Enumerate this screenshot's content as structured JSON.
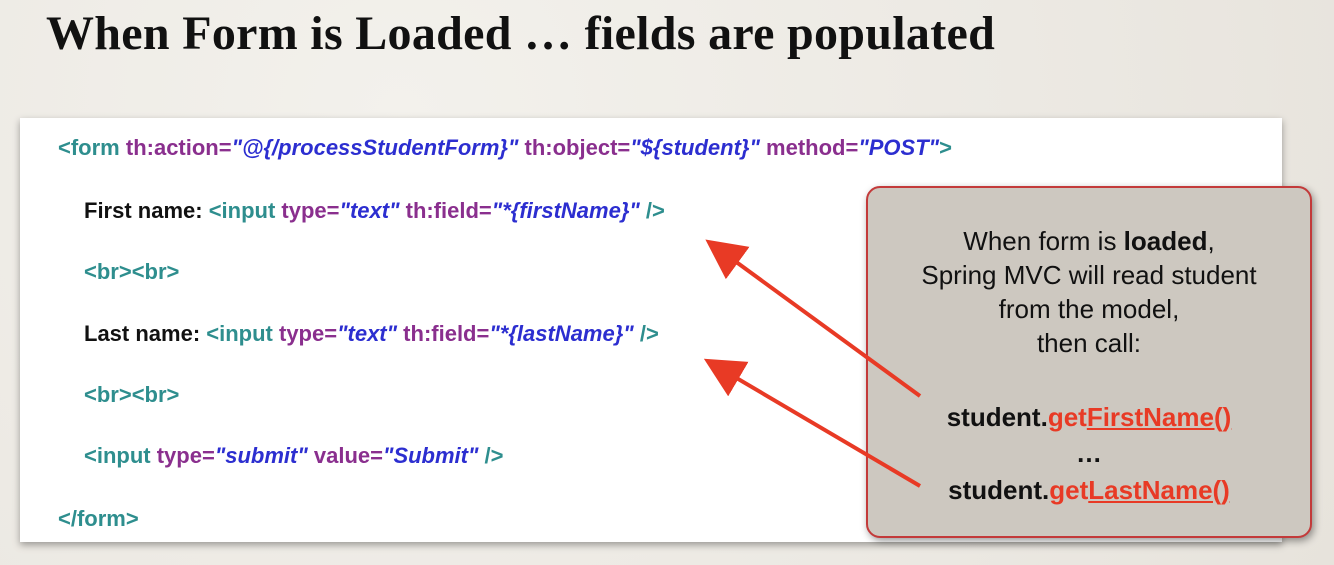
{
  "title": "When Form is Loaded … fields are populated",
  "code": {
    "line1": {
      "p1": "<form",
      "p2": " th:action=",
      "p3": "\"@{/processStudentForm}\"",
      "p4": " th:object=",
      "p5": "\"${student}\"",
      "p6": " method=",
      "p7": "\"POST\"",
      "p8": ">"
    },
    "line2": {
      "p0": "First name: ",
      "p1": "<input",
      "p2": " type=",
      "p3": "\"text\"",
      "p4": "  th:field=",
      "p5": "\"*{firstName}\"",
      "p6": " />"
    },
    "line3": "<br><br>",
    "line4": {
      "p0": "Last name: ",
      "p1": "<input",
      "p2": " type=",
      "p3": "\"text\"",
      "p4": "  th:field=",
      "p5": "\"*{lastName}\"",
      "p6": " />"
    },
    "line5": "<br><br>",
    "line6": {
      "p1": "<input",
      "p2": " type=",
      "p3": "\"submit\"",
      "p4": " value=",
      "p5": "\"Submit\"",
      "p6": " />"
    },
    "line7": "</form>"
  },
  "callout": {
    "l1_pre": "When form is ",
    "l1_bold": "loaded",
    "l1_post": ",",
    "l2": "Spring MVC will read student",
    "l3": "from the model,",
    "l4": "then call:",
    "c1_obj": "student.",
    "c1_get": "get",
    "c1_name": "FirstName()",
    "ellipsis": "…",
    "c2_obj": "student.",
    "c2_get": "get",
    "c2_name": "LastName()"
  },
  "colors": {
    "tag": "#2e8e8e",
    "attribute": "#8a2f8e",
    "value": "#2c2ed0",
    "arrow": "#e83a25",
    "callout_bg": "#cdc8c0",
    "callout_border": "#c33a3a"
  }
}
